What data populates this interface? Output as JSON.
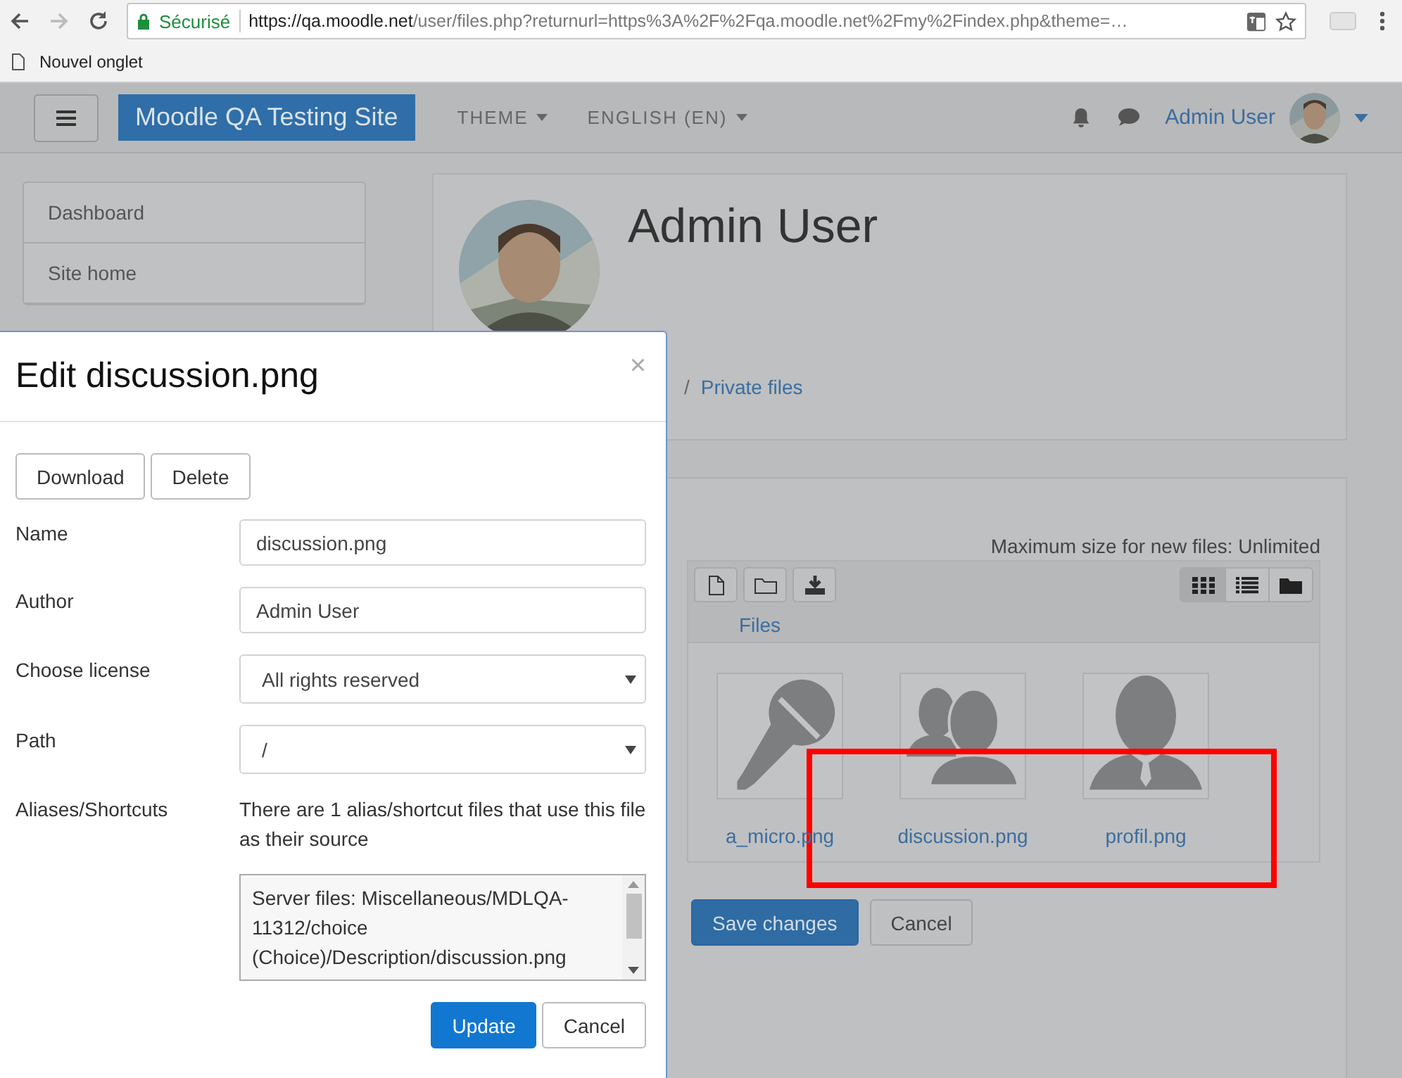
{
  "browser": {
    "secure_label": "Sécurisé",
    "url_host": "https://qa.moodle.net",
    "url_path": "/user/files.php?returnurl=https%3A%2F%2Fqa.moodle.net%2Fmy%2Findex.php&theme=…",
    "bookmarks": [
      {
        "label": "Nouvel onglet"
      }
    ]
  },
  "navbar": {
    "site_name": "Moodle QA Testing Site",
    "menus": [
      {
        "label": "THEME"
      },
      {
        "label": "ENGLISH (EN)"
      }
    ],
    "user_name": "Admin User"
  },
  "sidebar": {
    "items": [
      {
        "label": "Dashboard"
      },
      {
        "label": "Site home"
      }
    ]
  },
  "profile": {
    "name": "Admin User",
    "breadcrumb": [
      {
        "separator": "/",
        "label": "Private files"
      }
    ]
  },
  "files": {
    "max_size": "Maximum size for new files: Unlimited",
    "path_label": "Files",
    "views": [
      {
        "kind": "icons",
        "selected": true
      },
      {
        "kind": "list",
        "selected": false
      },
      {
        "kind": "tree",
        "selected": false
      }
    ],
    "items": [
      {
        "name": "a_micro.png",
        "kind": "microphone"
      },
      {
        "name": "discussion.png",
        "kind": "people"
      },
      {
        "name": "profil.png",
        "kind": "person"
      }
    ],
    "buttons": [
      {
        "label": "Save changes",
        "kind": "primary"
      },
      {
        "label": "Cancel",
        "kind": "secondary"
      }
    ]
  },
  "annotation": {
    "kind": "rectangle"
  },
  "dialog": {
    "title": "Edit discussion.png",
    "close": "×",
    "actions": [
      {
        "label": "Download"
      },
      {
        "label": "Delete"
      }
    ],
    "fields": [
      {
        "kind": "text",
        "label": "Name",
        "value": "discussion.png"
      },
      {
        "kind": "text",
        "label": "Author",
        "value": "Admin User"
      },
      {
        "kind": "select",
        "label": "Choose license",
        "value": "All rights reserved"
      },
      {
        "kind": "select",
        "label": "Path",
        "value": "/"
      },
      {
        "kind": "info",
        "label": "Aliases/Shortcuts",
        "text": "There are 1 alias/shortcut files that use this file as their source",
        "list": "Server files: Miscellaneous/MDLQA-11312/choice (Choice)/Description/discussion.png"
      }
    ],
    "buttons": [
      {
        "label": "Update",
        "kind": "primary"
      },
      {
        "label": "Cancel",
        "kind": "secondary"
      }
    ]
  }
}
